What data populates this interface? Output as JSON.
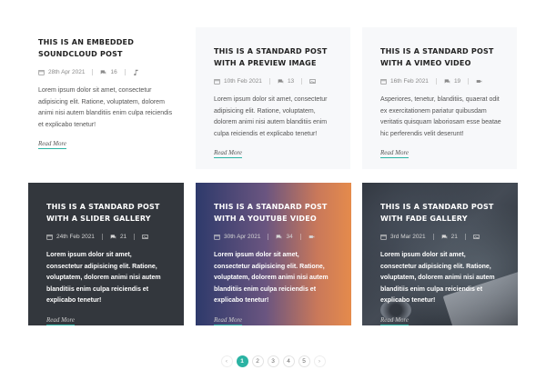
{
  "colors": {
    "accent": "#2bb3a3",
    "light_card": "#f7f8fa",
    "dark_card": "#33373d"
  },
  "posts": [
    {
      "title": "THIS IS AN EMBEDDED SOUNDCLOUD POST",
      "date": "28th Apr 2021",
      "comments": "16",
      "format_icon": "music-note-icon",
      "excerpt": "Lorem ipsum dolor sit amet, consectetur adipisicing elit. Ratione, voluptatem, dolorem animi nisi autem blanditiis enim culpa reiciendis et explicabo tenetur!",
      "read_more": "Read More"
    },
    {
      "title": "THIS IS A STANDARD POST WITH A PREVIEW IMAGE",
      "date": "10th Feb 2021",
      "comments": "13",
      "format_icon": "image-icon",
      "excerpt": "Lorem ipsum dolor sit amet, consectetur adipisicing elit. Ratione, voluptatem, dolorem animi nisi autem blanditiis enim culpa reiciendis et explicabo tenetur!",
      "read_more": "Read More"
    },
    {
      "title": "THIS IS A STANDARD POST WITH A VIMEO VIDEO",
      "date": "16th Feb 2021",
      "comments": "19",
      "format_icon": "video-icon",
      "excerpt": "Asperiores, tenetur, blanditiis, quaerat odit ex exercitationem pariatur quibusdam veritatis quisquam laboriosam esse beatae hic perferendis velit deserunt!",
      "read_more": "Read More"
    },
    {
      "title": "THIS IS A STANDARD POST WITH A SLIDER GALLERY",
      "date": "24th Feb 2021",
      "comments": "21",
      "format_icon": "image-icon",
      "excerpt": "Lorem ipsum dolor sit amet, consectetur adipisicing elit. Ratione, voluptatem, dolorem animi nisi autem blanditiis enim culpa reiciendis et explicabo tenetur!",
      "read_more": "Read More"
    },
    {
      "title": "THIS IS A STANDARD POST WITH A YOUTUBE VIDEO",
      "date": "30th Apr 2021",
      "comments": "34",
      "format_icon": "video-icon",
      "excerpt": "Lorem ipsum dolor sit amet, consectetur adipisicing elit. Ratione, voluptatem, dolorem animi nisi autem blanditiis enim culpa reiciendis et explicabo tenetur!",
      "read_more": "Read More"
    },
    {
      "title": "THIS IS A STANDARD POST WITH FADE GALLERY",
      "date": "3rd Mar 2021",
      "comments": "21",
      "format_icon": "image-icon",
      "excerpt": "Lorem ipsum dolor sit amet, consectetur adipisicing elit. Ratione, voluptatem, dolorem animi nisi autem blanditiis enim culpa reiciendis et explicabo tenetur!",
      "read_more": "Read More"
    }
  ],
  "pagination": {
    "prev": "‹",
    "pages": [
      "1",
      "2",
      "3",
      "4",
      "5"
    ],
    "current": "1",
    "next": "›"
  }
}
